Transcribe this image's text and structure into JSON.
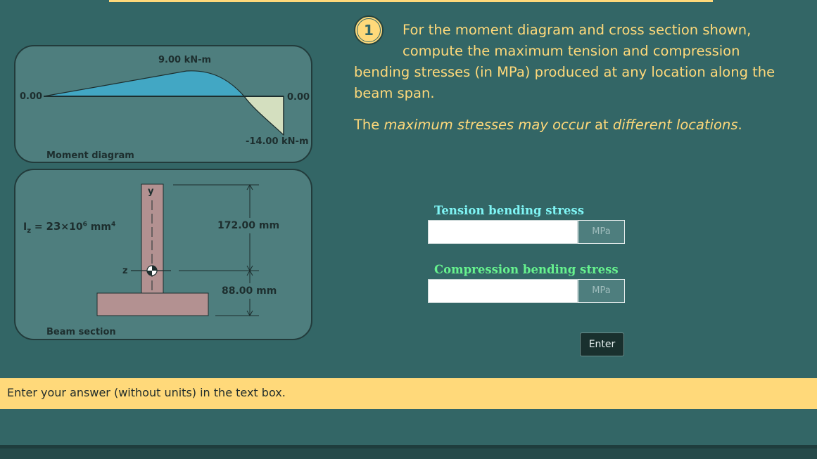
{
  "moment_diagram": {
    "panel_label": "Moment diagram",
    "max_moment_label": "9.00 kN-m",
    "min_moment_label": "-14.00 kN-m",
    "left_zero_label": "0.00",
    "right_zero_label": "0.00",
    "colors": {
      "positive": "#42a7c4",
      "negative": "#d4dfbf"
    }
  },
  "beam_section": {
    "panel_label": "Beam section",
    "inertia_symbol": "I",
    "inertia_subscript": "z",
    "inertia_equals": " = ",
    "inertia_value": "23",
    "inertia_times": "×10",
    "inertia_exponent": "6",
    "inertia_unit": " mm",
    "inertia_unit_exponent": "4",
    "y_axis_label": "y",
    "z_axis_label": "z",
    "dim_top_label": "172.00 mm",
    "dim_bottom_label": "88.00 mm",
    "colors": {
      "section": "#b39191"
    }
  },
  "problem": {
    "number": "1",
    "line1": "For the moment diagram and cross section shown,",
    "line2": "compute the maximum tension and compression",
    "line3": "bending stresses (in MPa) produced at any location along the",
    "line4": "beam span.",
    "note_prefix": "The ",
    "note_em1": "maximum stresses may occur",
    "note_mid": " at ",
    "note_em2": "different locations",
    "note_suffix": "."
  },
  "answers": {
    "tension_label": "Tension bending stress",
    "tension_value": "",
    "tension_unit": "MPa",
    "compression_label": "Compression bending stress",
    "compression_value": "",
    "compression_unit": "MPa",
    "colors": {
      "tension": "#7ff5f5",
      "compression": "#66f28e"
    }
  },
  "enter_button": "Enter",
  "hint": "Enter your answer (without units) in the text box."
}
